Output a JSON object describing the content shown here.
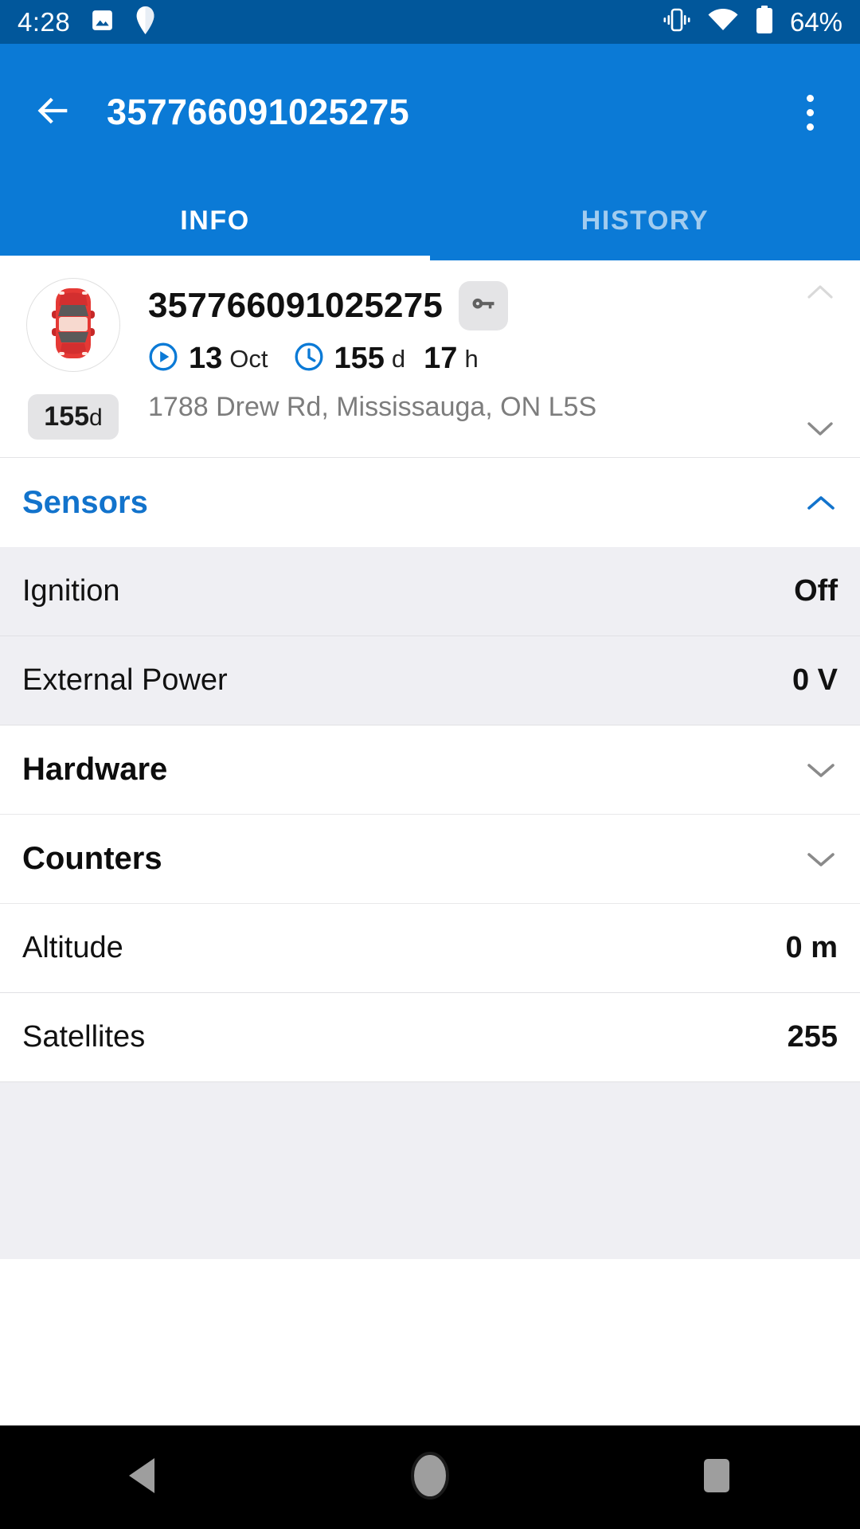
{
  "status_bar": {
    "time": "4:28",
    "icons_left": [
      "image-icon",
      "location-pin-icon"
    ],
    "icons_right": [
      "vibrate-icon",
      "wifi-icon",
      "battery-icon"
    ],
    "battery_text": "64%",
    "background_color": "#01579B"
  },
  "app_bar": {
    "back_icon": "arrow-back-icon",
    "title": "357766091025275",
    "overflow_icon": "overflow-menu-icon",
    "background_color": "#0B7AD6"
  },
  "tabs": {
    "items": [
      {
        "label": "INFO",
        "active": true
      },
      {
        "label": "HISTORY",
        "active": false
      }
    ]
  },
  "device_card": {
    "avatar_icon": "car-top-view-icon",
    "age_badge_value": "155",
    "age_badge_unit": "d",
    "name": "357766091025275",
    "key_icon": "key-icon",
    "date_icon": "play-circle-icon",
    "date_value": "13",
    "date_unit": "Oct",
    "duration_icon": "clock-icon",
    "duration_days_value": "155",
    "duration_days_unit": "d",
    "duration_hours_value": "17",
    "duration_hours_unit": "h",
    "address": "1788 Drew Rd, Mississauga, ON L5S",
    "chevron_up_icon": "chevron-up-icon",
    "chevron_down_icon": "chevron-down-icon"
  },
  "sections": {
    "sensors": {
      "title": "Sensors",
      "expanded": true,
      "chevron_icon": "chevron-up-icon",
      "accent_color": "#1273CC",
      "rows": [
        {
          "label": "Ignition",
          "value": "Off"
        },
        {
          "label": "External Power",
          "value": "0 V"
        }
      ]
    },
    "hardware": {
      "title": "Hardware",
      "expanded": false,
      "chevron_icon": "chevron-down-icon"
    },
    "counters": {
      "title": "Counters",
      "expanded": false,
      "chevron_icon": "chevron-down-icon"
    }
  },
  "extra_rows": [
    {
      "label": "Altitude",
      "value": "0 m"
    },
    {
      "label": "Satellites",
      "value": "255"
    }
  ],
  "nav_bar": {
    "back_icon": "nav-back-triangle-icon",
    "home_icon": "nav-home-circle-icon",
    "recents_icon": "nav-recents-square-icon"
  }
}
